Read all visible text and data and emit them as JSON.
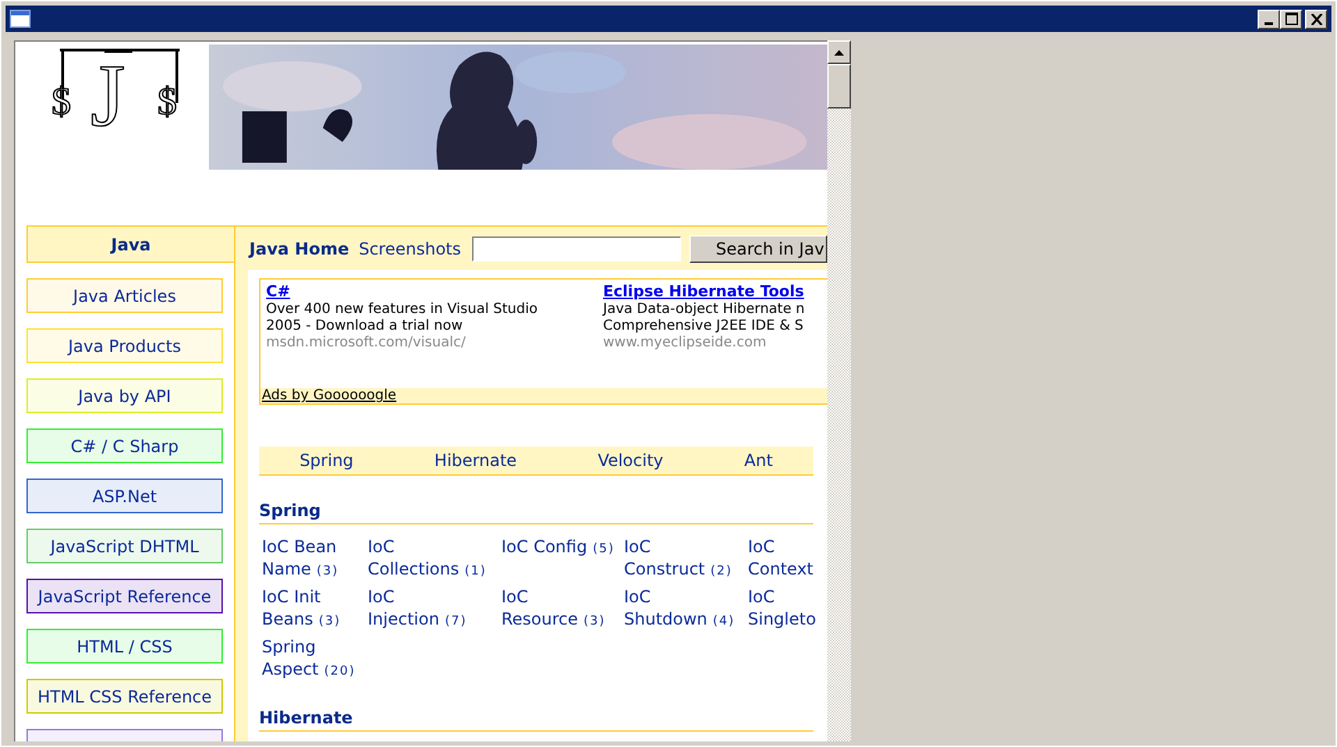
{
  "logo": {
    "left": "$",
    "center": "J",
    "right": "$"
  },
  "sidebar": {
    "title": "Java",
    "items": [
      {
        "label": "Java Articles",
        "color": "#ffcc33"
      },
      {
        "label": "Java Products",
        "color": "#ffe033"
      },
      {
        "label": "Java by API",
        "color": "#ddee22"
      },
      {
        "label": "C# / C Sharp",
        "color": "#33ee33"
      },
      {
        "label": "ASP.Net",
        "color": "#3366cc"
      },
      {
        "label": "JavaScript DHTML",
        "color": "#66cc66"
      },
      {
        "label": "JavaScript Reference",
        "color": "#5511aa"
      },
      {
        "label": "HTML / CSS",
        "color": "#33ee33"
      },
      {
        "label": "HTML CSS Reference",
        "color": "#cccc00"
      },
      {
        "color": "#9977dd"
      }
    ]
  },
  "nav": {
    "home": "Java Home",
    "links": [
      "Screenshots"
    ],
    "search": {
      "button": "Search in Jav"
    }
  },
  "ads": {
    "items": [
      {
        "title": "C#",
        "lines": [
          "Over 400 new features in Visual Studio",
          "2005 - Download a trial now"
        ],
        "url": "msdn.microsoft.com/visualc/"
      },
      {
        "title": "Eclipse Hibernate Tools",
        "lines": [
          "Java Data-object Hibernate n",
          "Comprehensive J2EE IDE & S"
        ],
        "url": "www.myeclipseide.com"
      }
    ],
    "footer": "Ads by Goooooogle"
  },
  "tabs": [
    "Spring",
    "Hibernate",
    "Velocity",
    "Ant"
  ],
  "sections": [
    {
      "title": "Spring",
      "links": [
        {
          "label": "IoC Bean Name",
          "count": "(3)"
        },
        {
          "label": "IoC Collections",
          "count": "(1)"
        },
        {
          "label": "IoC Config",
          "count": "(5)"
        },
        {
          "label": "IoC Construct",
          "count": "(2)"
        },
        {
          "label": "IoC Context"
        },
        {
          "label": "IoC Init Beans",
          "count": "(3)"
        },
        {
          "label": "IoC Injection",
          "count": "(7)"
        },
        {
          "label": "IoC Resource",
          "count": "(3)"
        },
        {
          "label": "IoC Shutdown",
          "count": "(4)"
        },
        {
          "label": "IoC Singleto"
        },
        {
          "label": "Spring Aspect",
          "count": "(20)"
        }
      ]
    },
    {
      "title": "Hibernate"
    }
  ]
}
